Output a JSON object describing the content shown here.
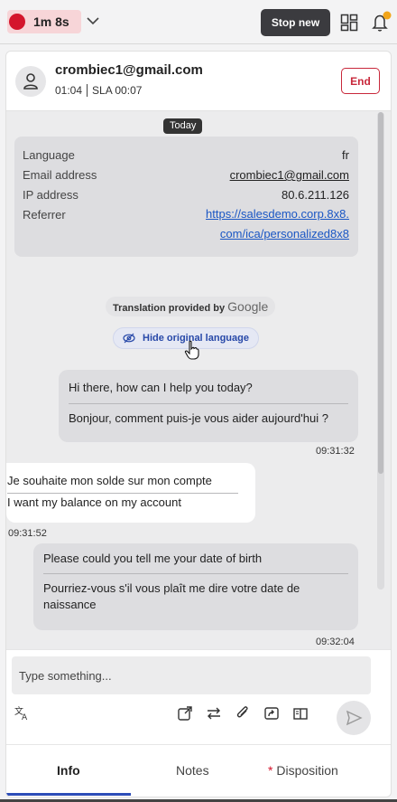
{
  "topbar": {
    "timer": "1m 8s",
    "stop_label": "Stop new",
    "colors": {
      "record": "#d4152c",
      "notification_badge": "#f2a51a"
    }
  },
  "contact": {
    "email": "crombiec1@gmail.com",
    "duration": "01:04",
    "sla": "SLA 00:07",
    "end_label": "End"
  },
  "chat": {
    "date_label": "Today",
    "info_rows": [
      {
        "key": "Language",
        "value": "fr"
      },
      {
        "key": "Email address",
        "value": "crombiec1@gmail.com"
      },
      {
        "key": "IP address",
        "value": "80.6.211.126"
      },
      {
        "key": "Referrer",
        "value_line1": "https://salesdemo.corp.8x8.",
        "value_line2": "com/ica/personalized8x8"
      }
    ],
    "translation_prefix": "Translation provided by",
    "translation_brand": "Google",
    "hide_original_label": "Hide original language",
    "messages": [
      {
        "sender": "agent",
        "original": "Hi there, how can I help you today?",
        "translated": "Bonjour, comment puis-je vous aider aujourd'hui ?",
        "time": "09:31:32"
      },
      {
        "sender": "customer",
        "original": "Je souhaite mon solde sur mon compte",
        "translated": "I want my balance on my account",
        "time": "09:31:52"
      },
      {
        "sender": "agent",
        "original": "Please could you tell me your date of birth",
        "translated_line1": "Pourriez-vous s'il vous plaît me dire votre date de",
        "translated_line2": "naissance",
        "time": "09:32:04"
      }
    ]
  },
  "composer": {
    "placeholder": "Type something...",
    "tools": [
      "translate-icon",
      "external-link-icon",
      "transfer-icon",
      "attachment-icon",
      "share-screen-icon",
      "knowledge-book-icon",
      "send-icon"
    ]
  },
  "tabs": [
    {
      "label": "Info",
      "active": true
    },
    {
      "label": "Notes",
      "active": false
    },
    {
      "label": "Disposition",
      "required_marker": "*",
      "active": false
    }
  ]
}
